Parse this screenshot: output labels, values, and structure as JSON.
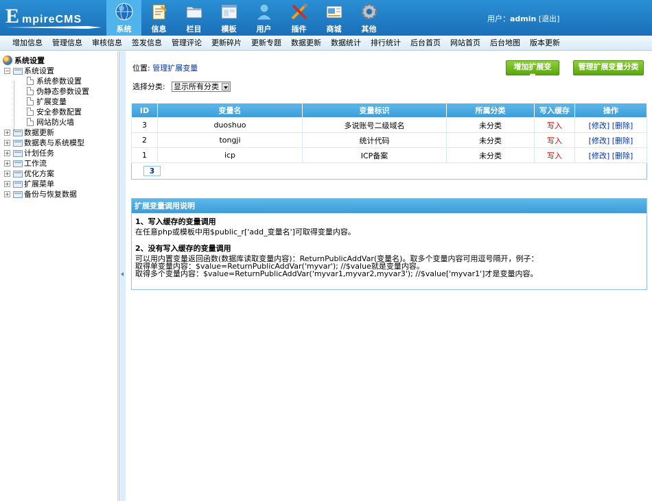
{
  "header": {
    "logo_big": "E",
    "logo_rest": "mpireCMS",
    "nav": [
      {
        "label": "系统",
        "icon": "globe-icon",
        "active": true
      },
      {
        "label": "信息",
        "icon": "notepad-icon"
      },
      {
        "label": "栏目",
        "icon": "folder-icon"
      },
      {
        "label": "模板",
        "icon": "window-icon"
      },
      {
        "label": "用户",
        "icon": "user-icon"
      },
      {
        "label": "插件",
        "icon": "tools-icon"
      },
      {
        "label": "商城",
        "icon": "card-icon"
      },
      {
        "label": "其他",
        "icon": "gear-icon"
      }
    ],
    "user_label": "用户：",
    "user_name": "admin",
    "logout": "[退出]"
  },
  "subnav": [
    "增加信息",
    "管理信息",
    "审核信息",
    "签发信息",
    "管理评论",
    "更新碎片",
    "更新专题",
    "数据更新",
    "数据统计",
    "排行统计",
    "后台首页",
    "网站首页",
    "后台地图",
    "版本更新"
  ],
  "sidebar": {
    "root": "系统设置",
    "group": "系统设置",
    "children": [
      "系统参数设置",
      "伪静态参数设置",
      "扩展变量",
      "安全参数配置",
      "网站防火墙"
    ],
    "others": [
      "数据更新",
      "数据表与系统模型",
      "计划任务",
      "工作流",
      "优化方案",
      "扩展菜单",
      "备份与恢复数据"
    ]
  },
  "main": {
    "pos_label": "位置:",
    "pos_link": "管理扩展变量",
    "btn_add": "增加扩展变量",
    "btn_manage": "管理扩展变量分类",
    "filter_label": "选择分类:",
    "filter_value": "显示所有分类",
    "table": {
      "headers": [
        "ID",
        "变量名",
        "变量标识",
        "所属分类",
        "写入缓存",
        "操作"
      ],
      "rows": [
        {
          "id": "3",
          "name": "duoshuo",
          "mark": "多说账号二级域名",
          "cat": "未分类",
          "cache": "写入",
          "edit": "[修改]",
          "del": "[删除]"
        },
        {
          "id": "2",
          "name": "tongji",
          "mark": "统计代码",
          "cat": "未分类",
          "cache": "写入",
          "edit": "[修改]",
          "del": "[删除]"
        },
        {
          "id": "1",
          "name": "icp",
          "mark": "ICP备案",
          "cat": "未分类",
          "cache": "写入",
          "edit": "[修改]",
          "del": "[删除]"
        }
      ],
      "page": "3"
    },
    "info": {
      "title": "扩展变量调用说明",
      "h1": "1、写入缓存的变量调用",
      "p1": "在任意php或模板中用$public_r['add_变量名']可取得变量内容。",
      "h2": "2、没有写入缓存的变量调用",
      "p2": "可以用内置变量返回函数(数据库读取变量内容)：ReturnPublicAddVar(变量名)。取多个变量内容可用逗号隔开，例子：",
      "p3": "取得单变量内容：$value=ReturnPublicAddVar('myvar'); //$value就是变量内容。",
      "p4": "取得多个变量内容：$value=ReturnPublicAddVar('myvar1,myvar2,myvar3'); //$value['myvar1']才是变量内容。"
    }
  },
  "colors": {
    "header": "#1a6fb8",
    "active_tab": "#4fb3ec",
    "button": "#5aa510",
    "grid_header": "#3d9bd8",
    "link": "#0033aa",
    "red": "#d40000"
  }
}
